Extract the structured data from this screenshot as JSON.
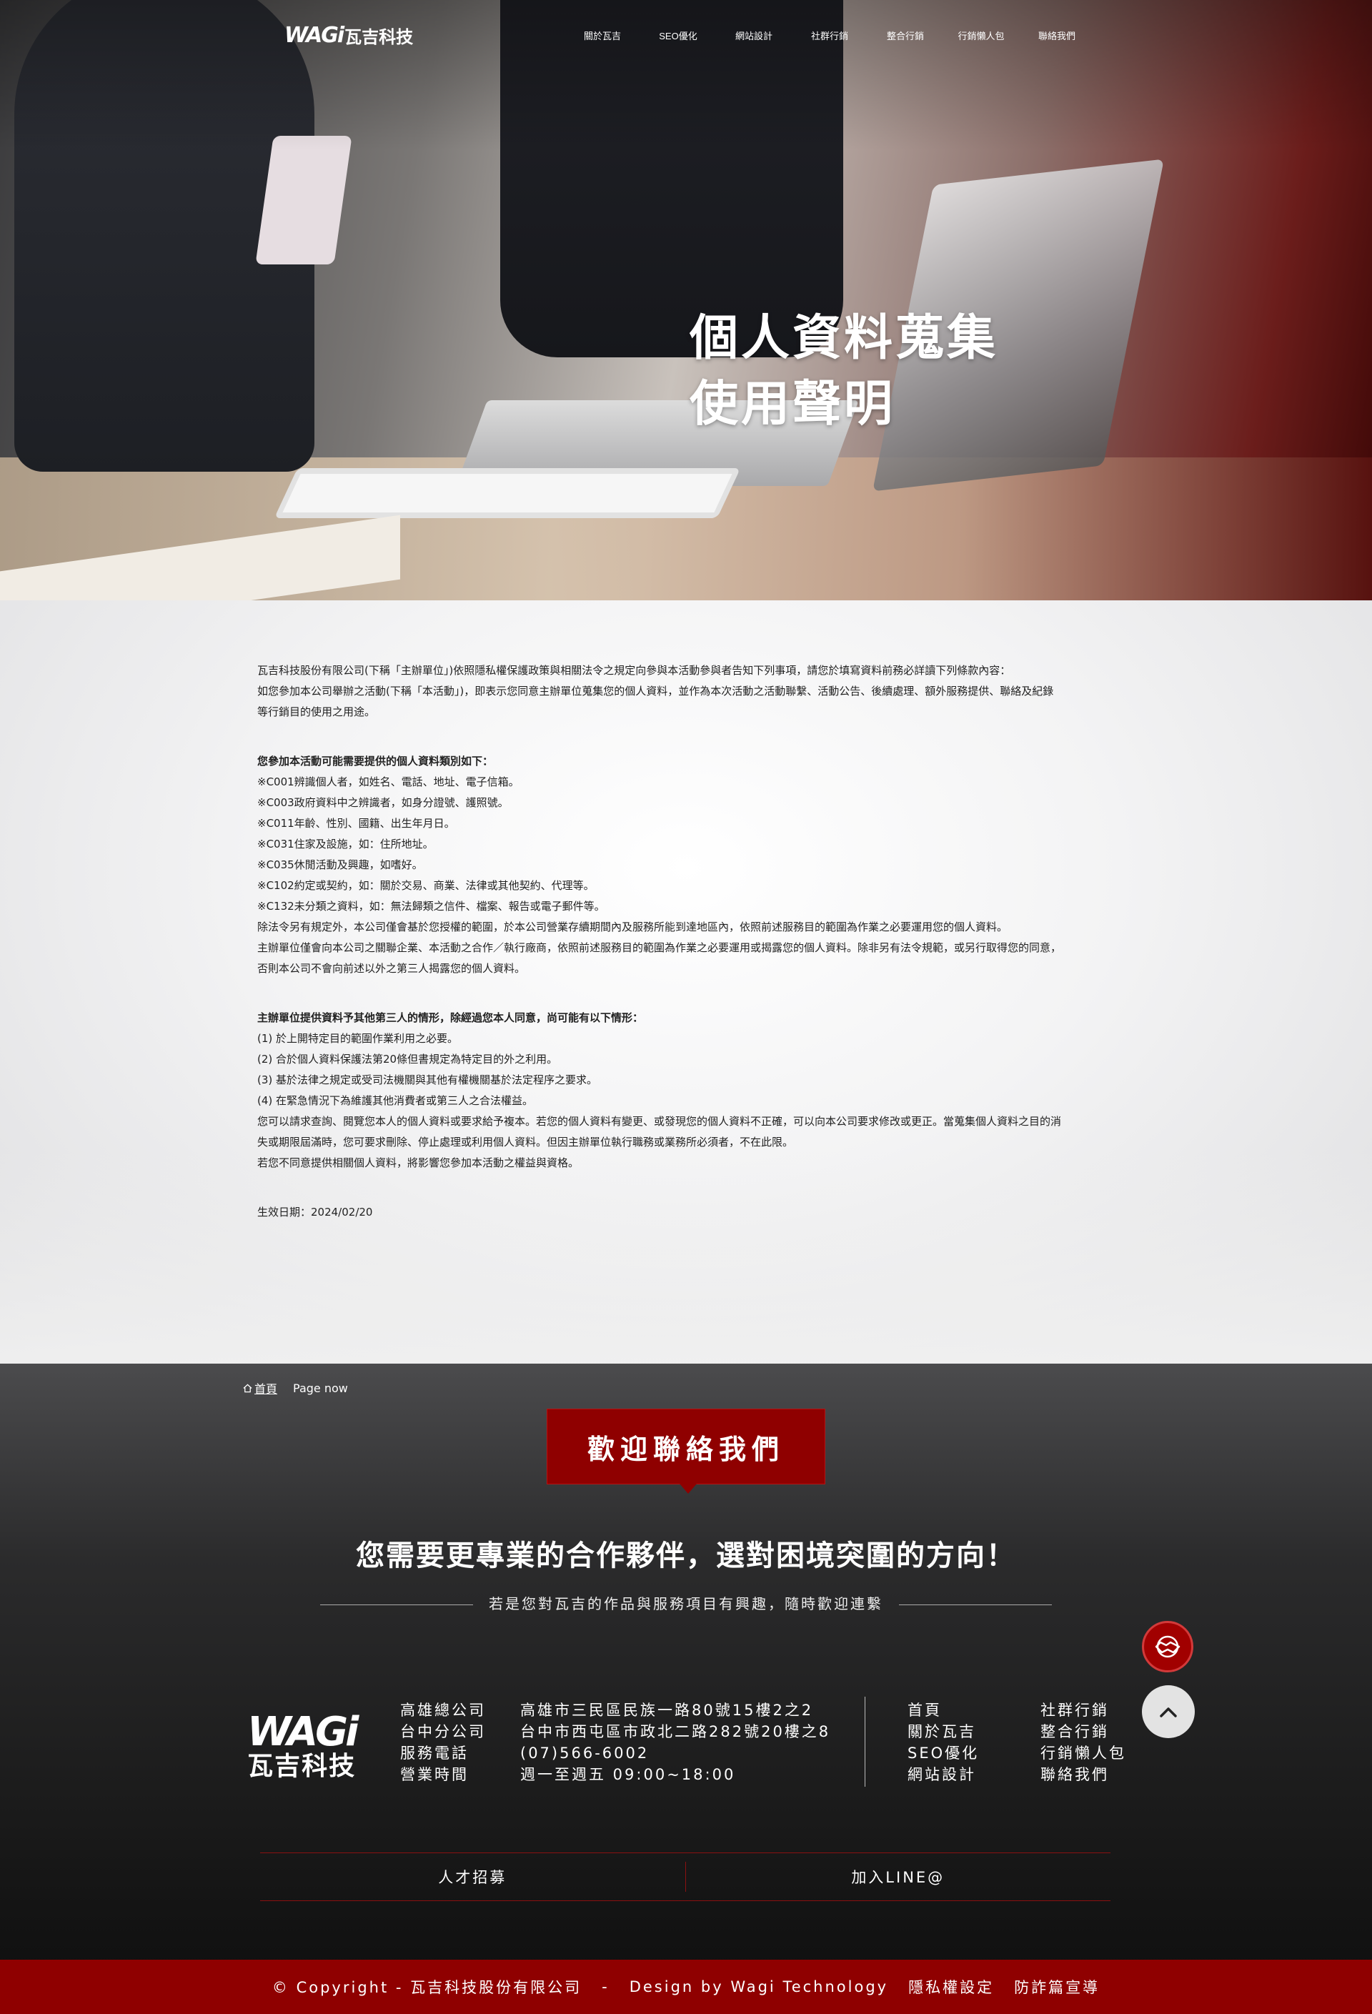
{
  "header": {
    "logo_text": "WAGi",
    "logo_cn": "瓦吉科技",
    "menu": [
      "關於瓦吉",
      "SEO優化",
      "網站設計",
      "社群行銷",
      "整合行銷",
      "行銷懶人包",
      "聯絡我們"
    ]
  },
  "hero": {
    "title_line1": "個人資料蒐集",
    "title_line2": "使用聲明"
  },
  "document": {
    "intro": [
      "瓦吉科技股份有限公司(下稱「主辦單位」)依照隱私權保護政策與相關法令之規定向參與本活動參與者告知下列事項，請您於填寫資料前務必詳讀下列條款內容：",
      "如您參加本公司舉辦之活動(下稱「本活動」)，即表示您同意主辦單位蒐集您的個人資料，並作為本次活動之活動聯繫、活動公告、後續處理、額外服務提供、聯絡及紀錄",
      "等行銷目的使用之用途。"
    ],
    "section1_heading": "您參加本活動可能需要提供的個人資料類別如下：",
    "section1_items": [
      "※C001辨識個人者，如姓名、電話、地址、電子信箱。",
      "※C003政府資料中之辨識者，如身分證號、護照號。",
      "※C011年齡、性別、國籍、出生年月日。",
      "※C031住家及設施，如：住所地址。",
      "※C035休閒活動及興趣，如嗜好。",
      "※C102約定或契約，如：關於交易、商業、法律或其他契約、代理等。",
      "※C132未分類之資料，如：無法歸類之信件、檔案、報告或電子郵件等。",
      "除法令另有規定外，本公司僅會基於您授權的範圍，於本公司營業存續期間內及服務所能到達地區內，依照前述服務目的範圍為作業之必要運用您的個人資料。",
      "主辦單位僅會向本公司之關聯企業、本活動之合作／執行廠商，依照前述服務目的範圍為作業之必要運用或揭露您的個人資料。除非另有法令規範，或另行取得您的同意，",
      "否則本公司不會向前述以外之第三人揭露您的個人資料。"
    ],
    "section2_heading": "主辦單位提供資料予其他第三人的情形，除經過您本人同意，尚可能有以下情形：",
    "section2_items": [
      "(1) 於上開特定目的範圍作業利用之必要。",
      "(2) 合於個人資料保護法第20條但書規定為特定目的外之利用。",
      "(3) 基於法律之規定或受司法機關與其他有權機關基於法定程序之要求。",
      "(4) 在緊急情況下為維護其他消費者或第三人之合法權益。",
      "您可以請求查詢、閱覽您本人的個人資料或要求給予複本。若您的個人資料有變更、或發現您的個人資料不正確，可以向本公司要求修改或更正。當蒐集個人資料之目的消",
      "失或期限屆滿時，您可要求刪除、停止處理或利用個人資料。但因主辦單位執行職務或業務所必須者，不在此限。",
      "若您不同意提供相關個人資料，將影響您參加本活動之權益與資格。"
    ],
    "effective_date": "生效日期：2024/02/20"
  },
  "breadcrumb": {
    "home": "首頁",
    "current": "Page now"
  },
  "contact": {
    "badge": "歡迎聯絡我們",
    "tagline": "您需要更專業的合作夥伴，選對困境突圍的方向！",
    "subline": "若是您對瓦吉的作品與服務項目有興趣，隨時歡迎連繫"
  },
  "footer": {
    "logo_text": "WAGi",
    "logo_cn": "瓦吉科技",
    "info": [
      {
        "label": "高雄總公司",
        "value": "高雄市三民區民族一路80號15樓2之2"
      },
      {
        "label": "台中分公司",
        "value": "台中市西屯區市政北二路282號20樓之8"
      },
      {
        "label": "服務電話",
        "value": "(07)566-6002"
      },
      {
        "label": "營業時間",
        "value": "週一至週五 09:00~18:00"
      }
    ],
    "links": [
      "首頁",
      "社群行銷",
      "關於瓦吉",
      "整合行銷",
      "SEO優化",
      "行銷懶人包",
      "網站設計",
      "聯絡我們"
    ],
    "bottom_links": [
      "人才招募",
      "加入LINE@"
    ],
    "copyright": [
      "© Copyright - 瓦吉科技股份有限公司",
      "-",
      "Design by Wagi Technology",
      "隱私權設定",
      "防詐篇宣導"
    ]
  },
  "colors": {
    "brand_red": "#8f0000",
    "footer_dark": "#1a1a1a"
  },
  "icons": {
    "float_contact": "handshake-icon",
    "to_top": "chevron-up-icon",
    "home": "home-icon"
  }
}
